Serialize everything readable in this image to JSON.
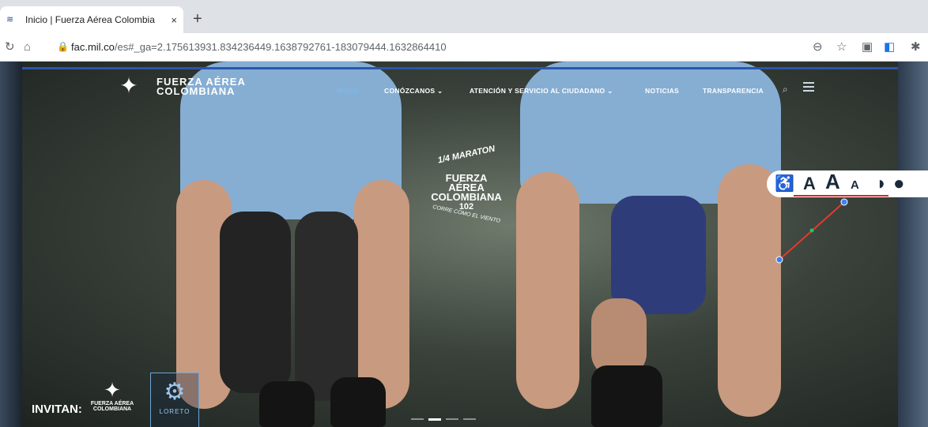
{
  "browser": {
    "tab_title": "Inicio | Fuerza Aérea Colombia",
    "tab_close": "×",
    "new_tab": "+",
    "url_domain": "fac.mil.co",
    "url_rest": "/es#_ga=2.175613931.834236449.1638792761-183079444.1632864410"
  },
  "site": {
    "brand_line1": "FUERZA AÉREA",
    "brand_line2": "COLOMBIANA",
    "nav": [
      {
        "label": "INICIO"
      },
      {
        "label": "CONÓZCANOS ⌄"
      },
      {
        "label": "ATENCIÓN Y SERVICIO AL CIUDADANO ⌄"
      },
      {
        "label": "NOTICIAS"
      },
      {
        "label": "TRANSPARENCIA"
      }
    ]
  },
  "hero": {
    "badge_line1": "1/4 MARATON",
    "badge_line2": "FUERZA AÉREA",
    "badge_line3": "COLOMBIANA",
    "badge_line4": "102",
    "badge_line5": "CORRE COMO EL VIENTO",
    "invitan": "INVITAN:",
    "sponsor1_line1": "FUERZA AÉREA",
    "sponsor1_line2": "COLOMBIANA",
    "sponsor2": "LORETO"
  },
  "accessibility": {
    "icon": "♿",
    "a_large": "A",
    "a_larger": "A",
    "a_small": "A"
  },
  "carousel": {
    "active_index": 1,
    "count": 4
  },
  "colors": {
    "accent": "#2a56b0",
    "nav_active": "#7fb7e8",
    "underline": "#dd2222"
  }
}
